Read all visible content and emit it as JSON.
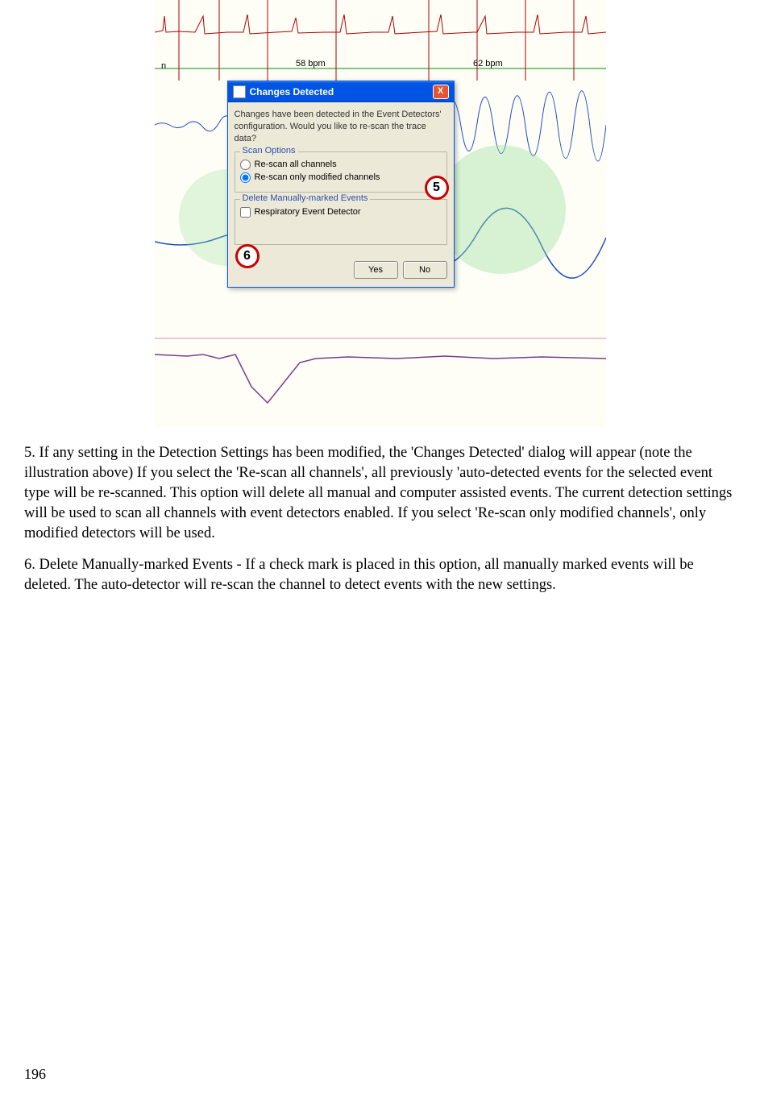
{
  "figure": {
    "n_label": "n",
    "bpm1": "58 bpm",
    "bpm2": "62 bpm"
  },
  "dialog": {
    "title": "Changes Detected",
    "close_glyph": "X",
    "message": "Changes have been detected in the Event Detectors' configuration. Would you like to re-scan the trace data?",
    "scan_group_title": "Scan Options",
    "radio_all": "Re-scan all channels",
    "radio_modified": "Re-scan only modified channels",
    "delete_group_title": "Delete Manually-marked Events",
    "check_resp": "Respiratory Event Detector",
    "yes_label": "Yes",
    "no_label": "No"
  },
  "callouts": {
    "five": "5",
    "six": "6"
  },
  "paragraphs": {
    "p5": "5.  If any setting in the Detection Settings has been modified, the 'Changes Detected' dialog will appear (note the illustration above) If you select the 'Re-scan all channels', all previously 'auto-detected events for the selected event type will be re-scanned.  This option will delete all manual and computer assisted events.  The current detection settings will be used to scan all channels with event detectors enabled.  If you select 'Re-scan only modified channels', only modified detectors will be used.",
    "p6": "6.  Delete Manually-marked Events - If a check mark is placed in this option, all manually marked events will be deleted.  The auto-detector will re-scan the channel to detect events with the new settings."
  },
  "page_number": "196"
}
